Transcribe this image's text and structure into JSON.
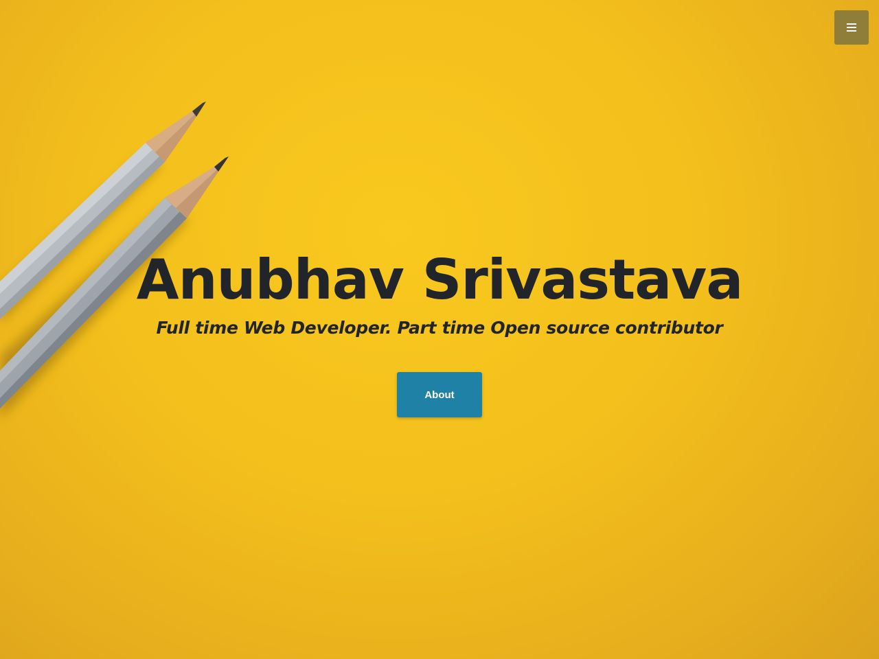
{
  "nav": {
    "menu_icon": "hamburger-menu-icon",
    "menu_button_color": "#8f7d3a"
  },
  "hero": {
    "title": "Anubhav Srivastava",
    "subtitle": "Full time Web Developer. Part time Open source contributor",
    "button_label": "About",
    "button_color": "#1e81a5",
    "text_color": "#212529",
    "background_color": "#f5c21c",
    "background_image": "two-pencils-on-yellow-paper"
  }
}
